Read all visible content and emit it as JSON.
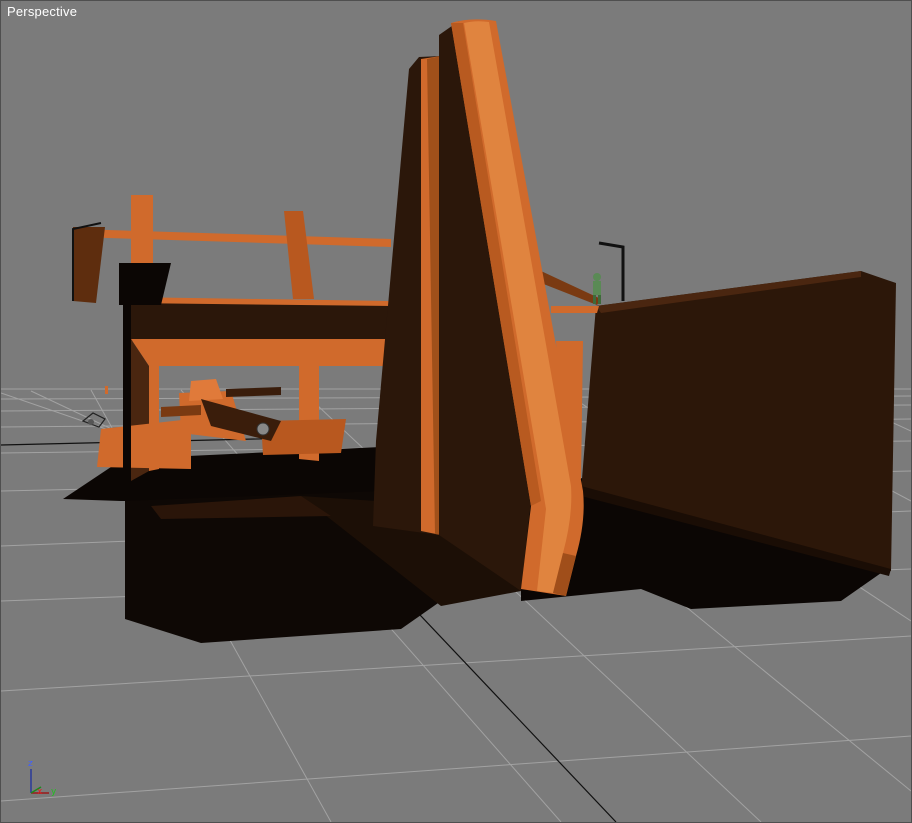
{
  "viewport": {
    "label": "Perspective",
    "background_color": "#7b7b7b",
    "grid_color": "#a0a0a0",
    "horizon_line_color": "#000000"
  },
  "model": {
    "lit_color": "#d06a2c",
    "mid_color": "#7a3a12",
    "dark_color": "#2b170a",
    "shadow_color": "#0b0604"
  },
  "axis_gizmo": {
    "z_label": "z",
    "x_label": "x",
    "y_label": "y",
    "z_color": "#4060ff",
    "x_color": "#e02020",
    "y_color": "#20c020"
  }
}
